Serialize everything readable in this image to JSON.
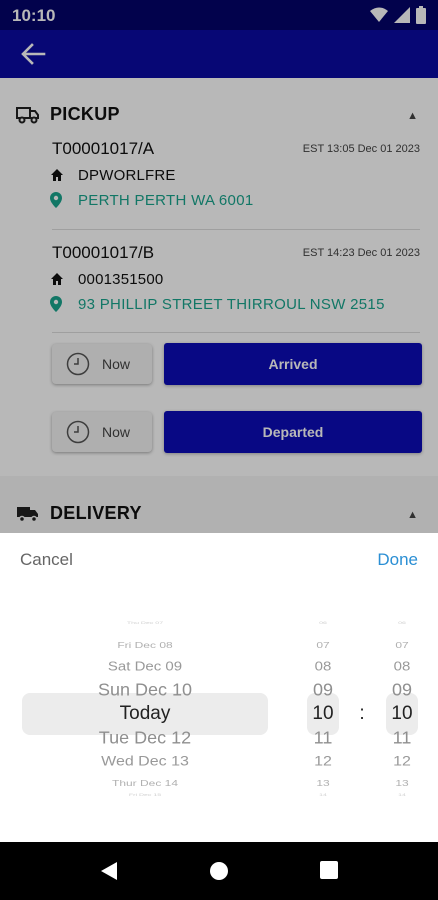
{
  "status_bar": {
    "time": "10:10"
  },
  "pickup": {
    "title": "PICKUP",
    "stops": [
      {
        "ref": "T00001017/A",
        "est": "EST 13:05 Dec 01 2023",
        "company": "DPWORLFRE",
        "address": "PERTH  PERTH WA 6001"
      },
      {
        "ref": "T00001017/B",
        "est": "EST 14:23 Dec 01 2023",
        "company": "0001351500",
        "address": "93 PHILLIP STREET  THIRROUL NSW 2515"
      }
    ],
    "actions": [
      {
        "now_label": "Now",
        "button_label": "Arrived"
      },
      {
        "now_label": "Now",
        "button_label": "Departed"
      }
    ]
  },
  "delivery": {
    "title": "DELIVERY"
  },
  "picker": {
    "cancel_label": "Cancel",
    "done_label": "Done",
    "separator": ":",
    "dates": [
      "Thu Dec 07",
      "Fri Dec 08",
      "Sat Dec 09",
      "Sun Dec 10",
      "Today",
      "Tue Dec 12",
      "Wed Dec 13",
      "Thur Dec 14",
      "Fri Dec 15"
    ],
    "hours": [
      "06",
      "07",
      "08",
      "09",
      "10",
      "11",
      "12",
      "13",
      "14"
    ],
    "minutes": [
      "06",
      "07",
      "08",
      "09",
      "10",
      "11",
      "12",
      "13",
      "14"
    ],
    "selected_index": 4
  },
  "colors": {
    "primary": "#0b0ba3",
    "accent_green": "#1aa58e",
    "done_blue": "#2b8fd4"
  }
}
